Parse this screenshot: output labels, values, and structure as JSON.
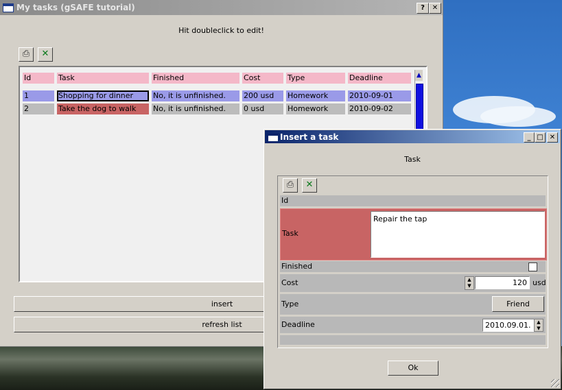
{
  "main_window": {
    "title": "My tasks (gSAFE tutorial)",
    "help_button": "?",
    "close_button": "✕",
    "hint": "Hit doubleclick to edit!",
    "toolbar": {
      "print_icon": "printer-icon",
      "excel_icon": "excel-icon"
    },
    "table": {
      "columns": [
        "Id",
        "Task",
        "Finished",
        "Cost",
        "Type",
        "Deadline"
      ],
      "rows": [
        {
          "id": "1",
          "task": "Shopping for dinner",
          "finished": "No, it is unfinished.",
          "cost": "200 usd",
          "type": "Homework",
          "deadline": "2010-09-01"
        },
        {
          "id": "2",
          "task": "Take the dog to walk",
          "finished": "No, it is unfinished.",
          "cost": "0 usd",
          "type": "Homework",
          "deadline": "2010-09-02"
        }
      ]
    },
    "insert_label": "insert",
    "refresh_label": "refresh list"
  },
  "dialog": {
    "title": "Insert a task",
    "minimize": "_",
    "maximize": "□",
    "close": "✕",
    "heading": "Task",
    "toolbar": {
      "print_icon": "printer-icon",
      "excel_icon": "excel-icon"
    },
    "fields": {
      "id_label": "Id",
      "task_label": "Task",
      "task_value": "Repair the tap",
      "finished_label": "Finished",
      "cost_label": "Cost",
      "cost_value": "120",
      "cost_unit": "usd",
      "type_label": "Type",
      "type_value": "Friend",
      "deadline_label": "Deadline",
      "deadline_value": "2010.09.01."
    },
    "ok_label": "Ok"
  },
  "colors": {
    "header_pink": "#f4b8c8",
    "selected_row": "#9a9ae8",
    "error_red": "#c86464",
    "title_active": "#0a246a"
  }
}
